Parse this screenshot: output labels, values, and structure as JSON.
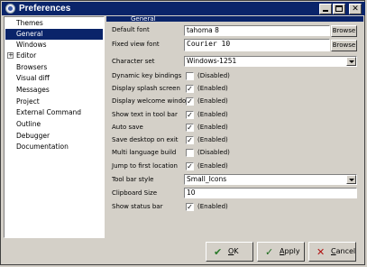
{
  "window": {
    "title": "Preferences",
    "minimize": "_",
    "maximize": "",
    "close": "✕"
  },
  "tree": {
    "items": [
      {
        "label": "Themes"
      },
      {
        "label": "General",
        "selected": true
      },
      {
        "label": "Windows"
      },
      {
        "label": "Editor",
        "expander": "+"
      },
      {
        "label": "Browsers"
      },
      {
        "label": "Visual diff"
      },
      {
        "label": "Messages"
      },
      {
        "label": "Project"
      },
      {
        "label": "External Command"
      },
      {
        "label": "Outline"
      },
      {
        "label": "Debugger"
      },
      {
        "label": "Documentation"
      }
    ]
  },
  "panel": {
    "title": "General",
    "default_font": {
      "label": "Default font",
      "value": "tahoma 8",
      "button": "Browse"
    },
    "fixed_font": {
      "label": "Fixed view font",
      "value": "Courier 10",
      "button": "Browse"
    },
    "charset": {
      "label": "Character set",
      "value": "Windows-1251"
    },
    "options": [
      {
        "label": "Dynamic key bindings",
        "checked": false,
        "state": "(Disabled)"
      },
      {
        "label": "Display splash screen",
        "checked": true,
        "state": "(Enabled)"
      },
      {
        "label": "Display welcome window",
        "checked": true,
        "state": "(Enabled)"
      },
      {
        "label": "Show text in tool bar",
        "checked": true,
        "state": "(Enabled)"
      },
      {
        "label": "Auto save",
        "checked": true,
        "state": "(Enabled)"
      },
      {
        "label": "Save desktop on exit",
        "checked": true,
        "state": "(Enabled)"
      },
      {
        "label": "Multi language build",
        "checked": false,
        "state": "(Disabled)"
      },
      {
        "label": "Jump to first location",
        "checked": true,
        "state": "(Enabled)"
      }
    ],
    "toolbar_style": {
      "label": "Tool bar style",
      "value": "Small_Icons"
    },
    "clipboard_size": {
      "label": "Clipboard Size",
      "value": "10"
    },
    "status_bar": {
      "label": "Show status bar",
      "checked": true,
      "state": "(Enabled)"
    }
  },
  "buttons": {
    "ok": {
      "label": "OK",
      "mnemonic": "O",
      "rest": "K",
      "icon": "ok-icon"
    },
    "apply": {
      "label": "Apply",
      "mnemonic": "A",
      "rest": "pply",
      "icon": "apply-icon"
    },
    "cancel": {
      "label": "Cancel",
      "mnemonic": "C",
      "rest": "ancel",
      "icon": "cancel-icon"
    }
  },
  "colors": {
    "titlebar": "#0a246a",
    "face": "#d4d0c8",
    "selection": "#0a246a"
  }
}
